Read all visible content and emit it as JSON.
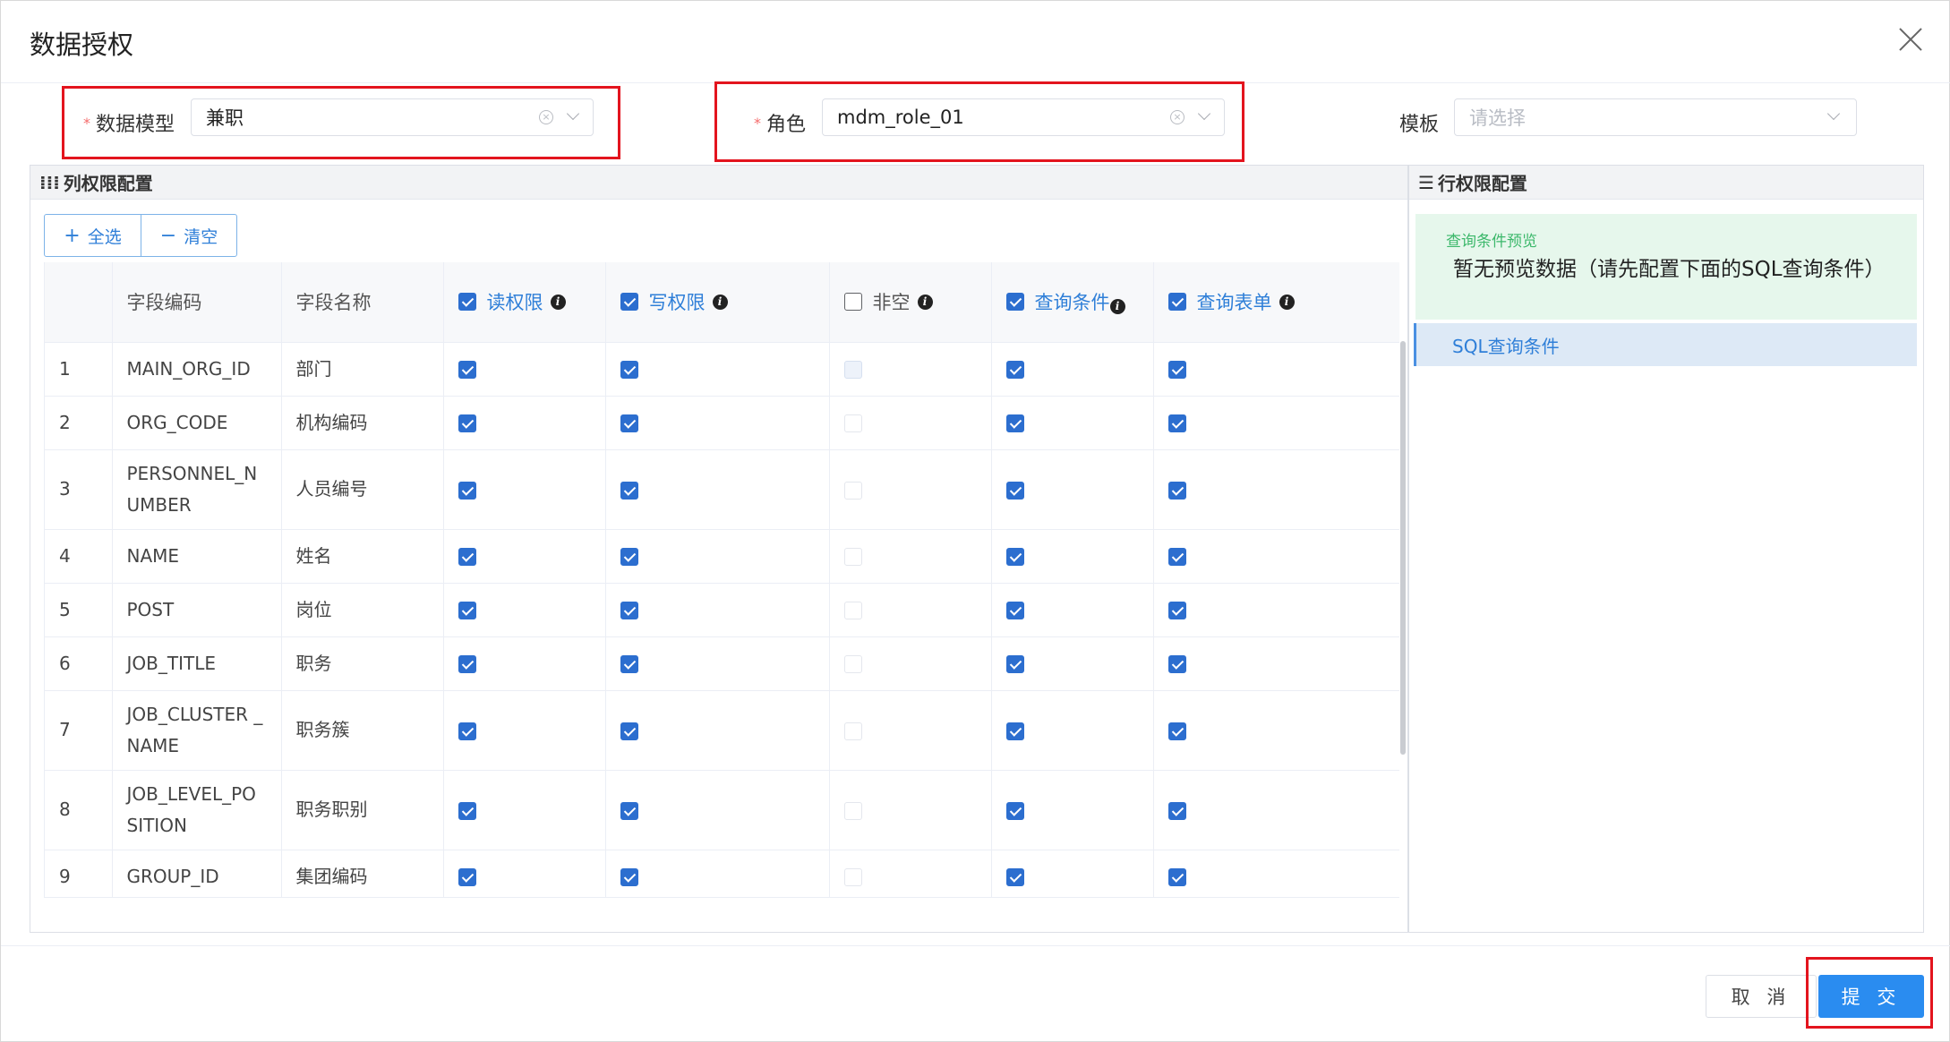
{
  "dialog": {
    "title": "数据授权"
  },
  "form": {
    "data_model": {
      "label": "数据模型",
      "required_mark": "*",
      "value": "兼职"
    },
    "role": {
      "label": "角色",
      "required_mark": "*",
      "value": "mdm_role_01"
    },
    "template": {
      "label": "模板",
      "placeholder": "请选择"
    }
  },
  "column_panel": {
    "icon": "column-bars-icon",
    "title": "列权限配置",
    "select_all": "全选",
    "clear": "清空",
    "headers": {
      "index": "",
      "code": "字段编码",
      "name": "字段名称",
      "read": {
        "label": "读权限",
        "checked": true
      },
      "write": {
        "label": "写权限",
        "checked": true
      },
      "notnull": {
        "label": "非空",
        "checked": false
      },
      "query": {
        "label": "查询条件",
        "checked": true
      },
      "form": {
        "label": "查询表单",
        "checked": true
      }
    },
    "rows": [
      {
        "index": "1",
        "code": "MAIN_ORG_ID",
        "name": "部门",
        "read": true,
        "write": true,
        "notnull": false,
        "query": true,
        "form": true
      },
      {
        "index": "2",
        "code": "ORG_CODE",
        "name": "机构编码",
        "read": true,
        "write": true,
        "notnull": false,
        "query": true,
        "form": true
      },
      {
        "index": "3",
        "code": "PERSONNEL_N UMBER",
        "name": "人员编号",
        "read": true,
        "write": true,
        "notnull": false,
        "query": true,
        "form": true
      },
      {
        "index": "4",
        "code": "NAME",
        "name": "姓名",
        "read": true,
        "write": true,
        "notnull": false,
        "query": true,
        "form": true
      },
      {
        "index": "5",
        "code": "POST",
        "name": "岗位",
        "read": true,
        "write": true,
        "notnull": false,
        "query": true,
        "form": true
      },
      {
        "index": "6",
        "code": "JOB_TITLE",
        "name": "职务",
        "read": true,
        "write": true,
        "notnull": false,
        "query": true,
        "form": true
      },
      {
        "index": "7",
        "code": "JOB_CLUSTER _NAME",
        "name": "职务簇",
        "read": true,
        "write": true,
        "notnull": false,
        "query": true,
        "form": true
      },
      {
        "index": "8",
        "code": "JOB_LEVEL_PO SITION",
        "name": "职务职别",
        "read": true,
        "write": true,
        "notnull": false,
        "query": true,
        "form": true
      },
      {
        "index": "9",
        "code": "GROUP_ID",
        "name": "集团编码",
        "read": true,
        "write": true,
        "notnull": false,
        "query": true,
        "form": true
      }
    ]
  },
  "row_panel": {
    "icon": "list-lines-icon",
    "title": "行权限配置",
    "preview_label": "查询条件预览",
    "preview_text": "暂无预览数据（请先配置下面的SQL查询条件）",
    "sql_item": "SQL查询条件"
  },
  "footer": {
    "cancel": "取 消",
    "submit": "提 交"
  },
  "colors": {
    "primary": "#2a8cf0",
    "checkbox": "#2c6ecf",
    "required": "#f56c6c",
    "highlight": "#e3141e",
    "preview_bg": "#e6f7ec"
  }
}
